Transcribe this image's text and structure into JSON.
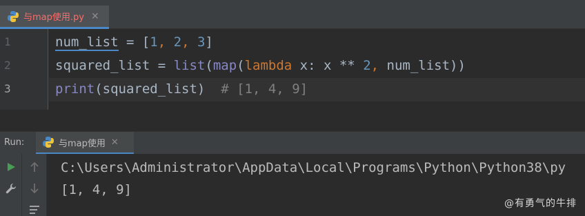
{
  "editor_tab": {
    "filename": "与map使用.py",
    "close": "✕"
  },
  "editor": {
    "line_numbers": [
      "1",
      "2",
      "3"
    ],
    "line1": {
      "var": "num_list",
      "eq": " = [",
      "n1": "1",
      "c1": ", ",
      "n2": "2",
      "c2": ", ",
      "n3": "3",
      "end": "]"
    },
    "line2": {
      "var": "squared_list = ",
      "list": "list",
      "p1": "(",
      "map": "map",
      "p2": "(",
      "lambda": "lambda",
      "body": " x: x ** ",
      "two": "2",
      "comma": ", ",
      "arg": "num_list))"
    },
    "line3": {
      "print": "print",
      "args": "(squared_list)",
      "comment": "  # [1, 4, 9]"
    }
  },
  "run_panel": {
    "label": "Run:",
    "tab_label": "与map使用",
    "close": "✕"
  },
  "console": {
    "lines": [
      "C:\\Users\\Administrator\\AppData\\Local\\Programs\\Python\\Python38\\py",
      "[1, 4, 9]"
    ]
  },
  "watermark": "@有勇气的牛排",
  "colors": {
    "accent": "#4a88c7",
    "run_green": "#499c54",
    "modified_tab_text": "#ff6b68"
  }
}
